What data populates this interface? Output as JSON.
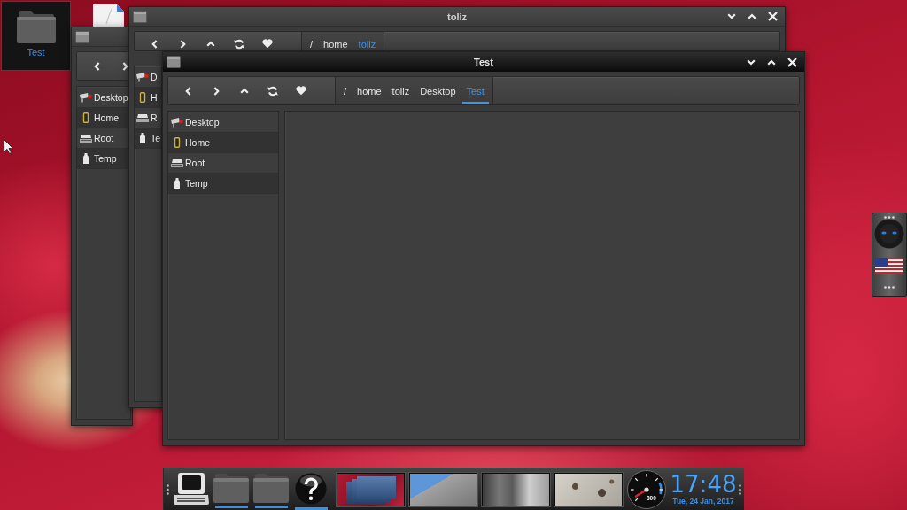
{
  "desktop_icons": [
    {
      "label": "Test",
      "selected": true
    }
  ],
  "windows": [
    {
      "active": false,
      "nav_buttons": [
        {
          "kind": "back"
        },
        {
          "kind": "forward"
        }
      ],
      "sidebar": [
        {
          "label": "Desktop",
          "kind": "desktop"
        },
        {
          "label": "Home",
          "kind": "home"
        },
        {
          "label": "Root",
          "kind": "root"
        },
        {
          "label": "Temp",
          "kind": "temp"
        }
      ]
    },
    {
      "title": "toliz",
      "active": false,
      "controls": [
        {
          "kind": "minimize"
        },
        {
          "kind": "maximize"
        },
        {
          "kind": "close"
        }
      ],
      "nav_buttons": [
        {
          "kind": "back"
        },
        {
          "kind": "forward"
        },
        {
          "kind": "up"
        },
        {
          "kind": "refresh"
        },
        {
          "kind": "bookmark"
        }
      ],
      "breadcrumb": [
        {
          "label": "/",
          "selected": false
        },
        {
          "label": "home",
          "selected": false
        },
        {
          "label": "toliz",
          "selected": true
        }
      ],
      "sidebar": [
        {
          "label": "D",
          "kind": "desktop"
        },
        {
          "label": "H",
          "kind": "home"
        },
        {
          "label": "R",
          "kind": "root"
        },
        {
          "label": "Te",
          "kind": "temp"
        }
      ]
    },
    {
      "title": "Test",
      "active": true,
      "controls": [
        {
          "kind": "minimize"
        },
        {
          "kind": "maximize"
        },
        {
          "kind": "close"
        }
      ],
      "nav_buttons": [
        {
          "kind": "back"
        },
        {
          "kind": "forward"
        },
        {
          "kind": "up"
        },
        {
          "kind": "refresh"
        },
        {
          "kind": "bookmark"
        }
      ],
      "breadcrumb": [
        {
          "label": "/",
          "selected": false
        },
        {
          "label": "home",
          "selected": false
        },
        {
          "label": "toliz",
          "selected": false
        },
        {
          "label": "Desktop",
          "selected": false
        },
        {
          "label": "Test",
          "selected": true
        }
      ],
      "sidebar": [
        {
          "label": "Desktop",
          "kind": "desktop"
        },
        {
          "label": "Home",
          "kind": "home"
        },
        {
          "label": "Root",
          "kind": "root"
        },
        {
          "label": "Temp",
          "kind": "temp"
        }
      ]
    }
  ],
  "dock": {
    "launchers": [
      {
        "kind": "computer",
        "running": false
      },
      {
        "kind": "folder",
        "running": true
      },
      {
        "kind": "folder",
        "running": true
      },
      {
        "kind": "help",
        "running": true
      }
    ],
    "workspaces": [
      {
        "kind": "windows"
      },
      {
        "kind": "photo"
      },
      {
        "kind": "photo"
      },
      {
        "kind": "photo"
      }
    ],
    "gauge": {
      "reading": "800"
    },
    "clock": {
      "time": "17:48",
      "date": "Tue, 24 Jan, 2017"
    }
  }
}
